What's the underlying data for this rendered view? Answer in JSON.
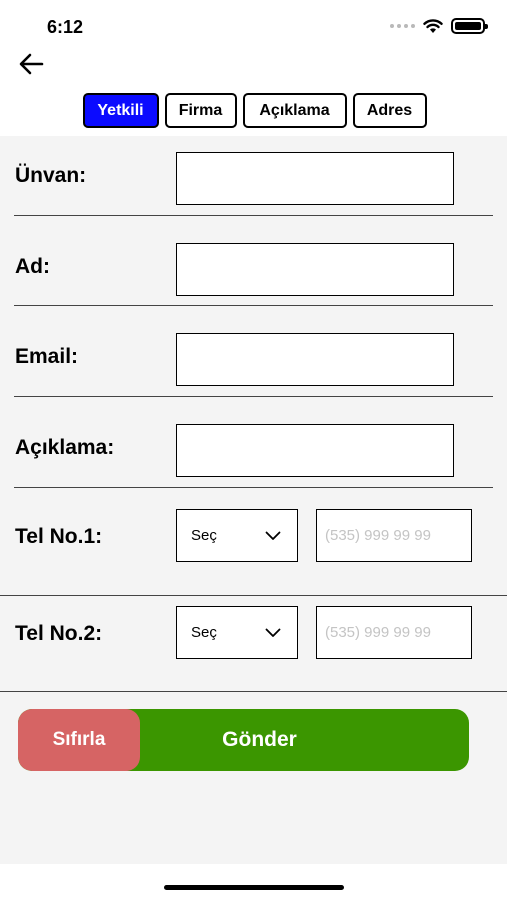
{
  "status_bar": {
    "time": "6:12"
  },
  "tabs": [
    {
      "label": "Yetkili",
      "active": true
    },
    {
      "label": "Firma",
      "active": false
    },
    {
      "label": "Açıklama",
      "active": false
    },
    {
      "label": "Adres",
      "active": false
    }
  ],
  "form": {
    "unvan_label": "Ünvan:",
    "ad_label": "Ad:",
    "email_label": "Email:",
    "aciklama_label": "Açıklama:",
    "tel1_label": "Tel No.1:",
    "tel2_label": "Tel No.2:",
    "unvan_value": "",
    "ad_value": "",
    "email_value": "",
    "aciklama_value": "",
    "tel1_country": "Seç",
    "tel2_country": "Seç",
    "phone_placeholder": "(535) 999 99 99"
  },
  "buttons": {
    "reset_label": "Sıfırla",
    "submit_label": "Gönder"
  },
  "colors": {
    "active_tab": "#0b0bff",
    "reset": "#d66464",
    "submit": "#3b9600"
  },
  "icons": [
    "back-arrow-icon",
    "wifi-icon",
    "battery-icon",
    "chevron-down-icon"
  ]
}
